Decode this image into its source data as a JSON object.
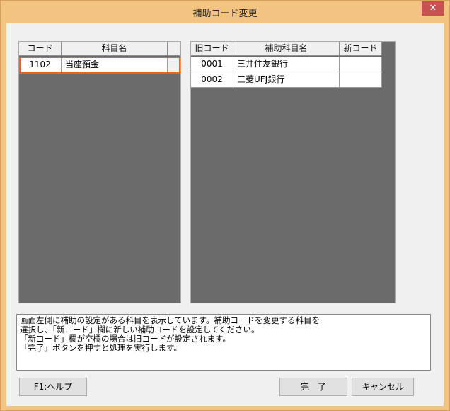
{
  "window": {
    "title": "補助コード変更",
    "close_glyph": "✕"
  },
  "left_grid": {
    "columns": [
      "コード",
      "科目名"
    ],
    "rows": [
      {
        "code": "1102",
        "name": "当座預金"
      }
    ]
  },
  "right_grid": {
    "columns": [
      "旧コード",
      "補助科目名",
      "新コード"
    ],
    "rows": [
      {
        "old_code": "0001",
        "name": "三井住友銀行",
        "new_code": ""
      },
      {
        "old_code": "0002",
        "name": "三菱UFJ銀行",
        "new_code": ""
      }
    ]
  },
  "message": {
    "lines": [
      "画面左側に補助の設定がある科目を表示しています。補助コードを変更する科目を",
      "選択し、「新コード」欄に新しい補助コードを設定してください。",
      "「新コード」欄が空欄の場合は旧コードが設定されます。",
      "「完了」ボタンを押すと処理を実行します。"
    ]
  },
  "buttons": {
    "help": "F1:ヘルプ",
    "done": "完　了",
    "cancel": "キャンセル"
  },
  "colors": {
    "frame": "#f3c481",
    "close": "#c75050",
    "grid_bg": "#6b6b6b",
    "selection": "#e8641e"
  }
}
